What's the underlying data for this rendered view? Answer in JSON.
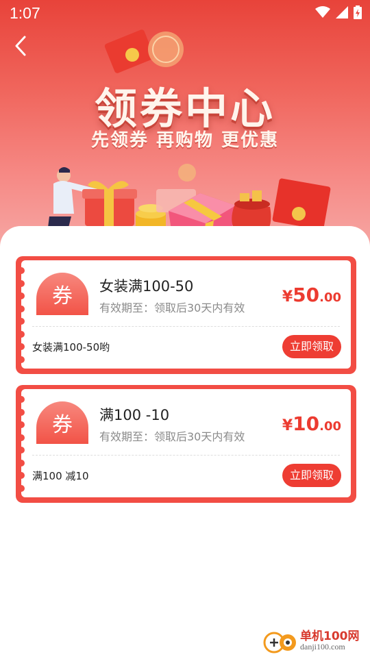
{
  "status_bar": {
    "time": "1:07"
  },
  "header": {
    "title": "领券中心",
    "subtitle": "先领券 再购物 更优惠"
  },
  "colors": {
    "primary": "#ee3d33",
    "coupon_border": "#f24d44",
    "price": "#ec3b30"
  },
  "coupons": [
    {
      "badge": "券",
      "title": "女装满100-50",
      "validity": "有效期至：领取后30天内有效",
      "currency": "¥",
      "amount": "50",
      "cents": ".00",
      "description": "女装满100-50哟",
      "button": "立即领取"
    },
    {
      "badge": "券",
      "title": "满100 -10",
      "validity": "有效期至：领取后30天内有效",
      "currency": "¥",
      "amount": "10",
      "cents": ".00",
      "description": "满100 减10",
      "button": "立即领取"
    }
  ],
  "watermark": {
    "name": "单机100网",
    "url": "danji100.com"
  }
}
